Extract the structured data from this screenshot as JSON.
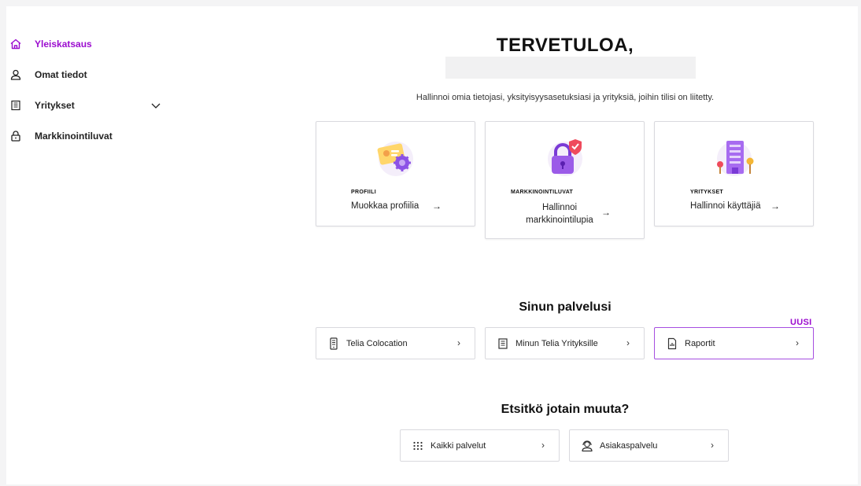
{
  "sidebar": {
    "items": [
      {
        "label": "Yleiskatsaus",
        "icon": "home-icon",
        "active": true
      },
      {
        "label": "Omat tiedot",
        "icon": "user-icon",
        "active": false
      },
      {
        "label": "Yritykset",
        "icon": "building-icon",
        "active": false,
        "expandable": true
      },
      {
        "label": "Markkinointiluvat",
        "icon": "lock-icon",
        "active": false
      }
    ]
  },
  "main": {
    "title": "TERVETULOA,",
    "subtitle": "Hallinnoi omia tietojasi, yksityisyysasetuksiasi ja yrityksiä, joihin tilisi on liitetty.",
    "cards": [
      {
        "kicker": "PROFIILI",
        "action": "Muokkaa profiilia",
        "arrow": "→",
        "illustration": "profile-card-gear-illustration"
      },
      {
        "kicker": "MARKKINOINTILUVAT",
        "action_line1": "Hallinnoi",
        "action_line2": "markkinointilupia",
        "arrow": "→",
        "illustration": "padlock-shield-illustration"
      },
      {
        "kicker": "YRITYKSET",
        "action": "Hallinnoi käyttäjiä",
        "arrow": "→",
        "illustration": "office-building-illustration"
      }
    ],
    "services": {
      "title": "Sinun palvelusi",
      "badge": "UUSI",
      "items": [
        {
          "label": "Telia Colocation",
          "icon": "phone-icon"
        },
        {
          "label": "Minun Telia Yrityksille",
          "icon": "building-icon"
        },
        {
          "label": "Raportit",
          "icon": "document-icon"
        }
      ]
    },
    "other": {
      "title": "Etsitkö jotain muuta?",
      "items": [
        {
          "label": "Kaikki palvelut",
          "icon": "grid-dots-icon"
        },
        {
          "label": "Asiakaspalvelu",
          "icon": "support-agent-icon"
        }
      ]
    },
    "chevron": "›"
  },
  "colors": {
    "accent": "#9b0ccf",
    "highlight_border": "#a64ee0",
    "border": "#d9d9de",
    "background": "#f4f4f5"
  }
}
